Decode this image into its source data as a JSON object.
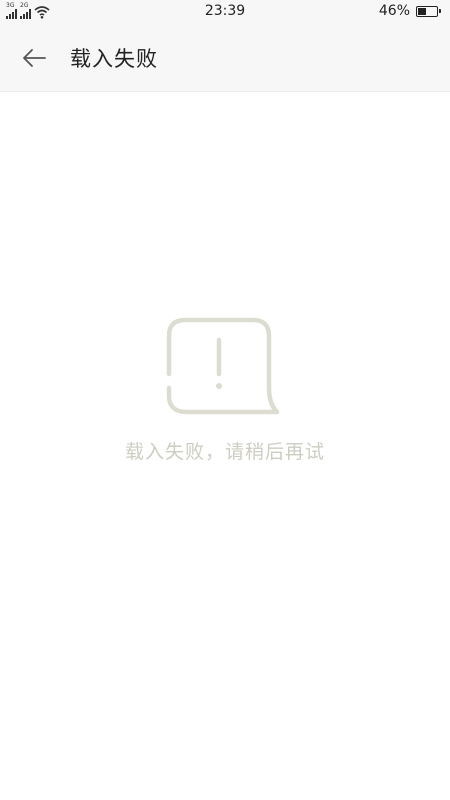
{
  "status_bar": {
    "network_1": "3G",
    "network_2": "2G",
    "time": "23:39",
    "battery_percent": "46%",
    "battery_level": 0.46
  },
  "app_bar": {
    "title": "载入失败",
    "back_icon": "arrow-left-icon"
  },
  "error": {
    "icon": "exclamation-speech-bubble-icon",
    "icon_color": "#dcdcd0",
    "message": "载入失败，请稍后再试"
  }
}
